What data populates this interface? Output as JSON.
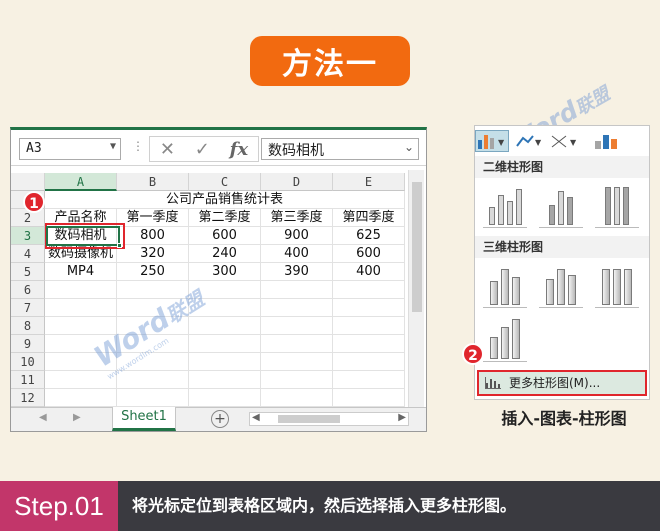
{
  "title": "方法一",
  "excel": {
    "name_box": "A3",
    "formula_value": "数码相机",
    "fx_label": "fx",
    "columns": [
      "A",
      "B",
      "C",
      "D",
      "E"
    ],
    "rows": [
      "1",
      "2",
      "3",
      "4",
      "5",
      "6",
      "7",
      "8",
      "9",
      "10",
      "11",
      "12"
    ],
    "table_title": "公司产品销售统计表",
    "headers": [
      "产品名称",
      "第一季度",
      "第二季度",
      "第三季度",
      "第四季度"
    ],
    "data": [
      [
        "数码相机",
        "800",
        "600",
        "900",
        "625"
      ],
      [
        "数码摄像机",
        "320",
        "240",
        "400",
        "600"
      ],
      [
        "MP4",
        "250",
        "300",
        "390",
        "400"
      ]
    ],
    "sheet_tab": "Sheet1",
    "add_sheet": "+"
  },
  "badges": [
    "1",
    "2"
  ],
  "menu": {
    "section_2d": "二维柱形图",
    "section_3d": "三维柱形图",
    "more_label": "更多柱形图(M)..."
  },
  "caption": "插入-图表-柱形图",
  "watermark": {
    "text": "Word",
    "text_cn": "联盟",
    "url": "www.wordlm.com"
  },
  "footer": {
    "step": "Step.01",
    "text": "将光标定位到表格区域内，然后选择插入更多柱形图。"
  },
  "colors": {
    "orange": "#f26a10",
    "excel_green": "#217346",
    "highlight_red": "#e0262d",
    "step_pink": "#c2366a",
    "footer_bg": "#3a3a40"
  }
}
